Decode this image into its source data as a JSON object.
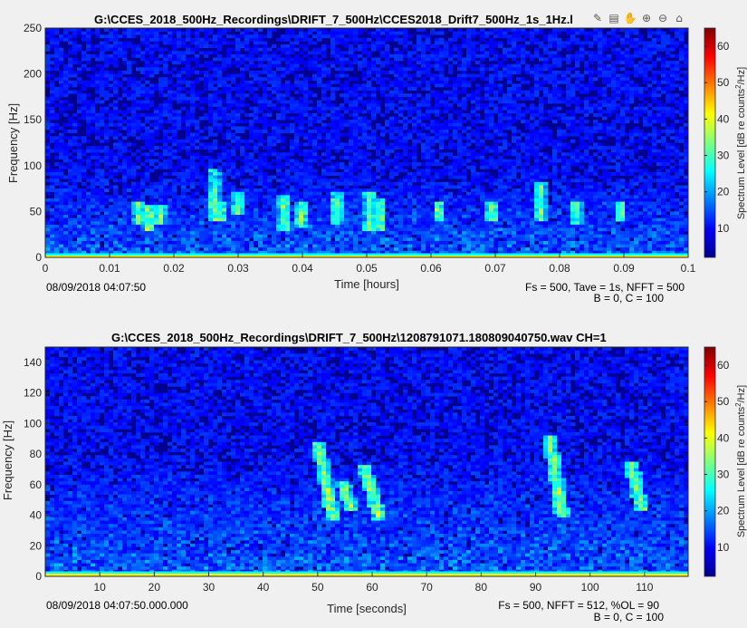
{
  "toolbar": {
    "icons": [
      "brush-icon",
      "legend-icon",
      "pan-hand-icon",
      "zoom-in-icon",
      "zoom-out-icon",
      "home-icon"
    ],
    "glyphs": [
      "✎",
      "▤",
      "✋",
      "⊕",
      "⊖",
      "⌂"
    ]
  },
  "chart_data": [
    {
      "type": "heatmap",
      "title": "G:\\CCES_2018_500Hz_Recordings\\DRIFT_7_500Hz\\CCES2018_Drift7_500Hz_1s_1Hz.l",
      "xlabel": "Time [hours]",
      "ylabel": "Frequency [Hz]",
      "xlim": [
        0,
        0.1
      ],
      "ylim": [
        0,
        250
      ],
      "xticks": [
        "0",
        "0.01",
        "0.02",
        "0.03",
        "0.04",
        "0.05",
        "0.06",
        "0.07",
        "0.08",
        "0.09",
        "0.1"
      ],
      "yticks": [
        "0",
        "50",
        "100",
        "150",
        "200",
        "250"
      ],
      "colorbar": {
        "label": "Spectrum Level [dB re counts²/Hz]",
        "label_main": "Spectrum Level [dB re counts",
        "label_sup": "2",
        "label_end": "/Hz]",
        "ticks": [
          "10",
          "20",
          "30",
          "40",
          "50",
          "60"
        ],
        "range": [
          2,
          65
        ]
      },
      "start_time": "08/09/2018 04:07:50",
      "info_line1": "Fs = 500, Tave = 1s, NFFT = 500",
      "info_line2": "B = 0, C = 100",
      "calls": [
        {
          "t": 0.0145,
          "f_hi": 62,
          "f_lo": 36
        },
        {
          "t": 0.0162,
          "f_hi": 58,
          "f_lo": 30
        },
        {
          "t": 0.0178,
          "f_hi": 56,
          "f_lo": 34
        },
        {
          "t": 0.0262,
          "f_hi": 95,
          "f_lo": 40
        },
        {
          "t": 0.0275,
          "f_hi": 60,
          "f_lo": 38
        },
        {
          "t": 0.03,
          "f_hi": 72,
          "f_lo": 45
        },
        {
          "t": 0.0372,
          "f_hi": 68,
          "f_lo": 28
        },
        {
          "t": 0.0398,
          "f_hi": 62,
          "f_lo": 32
        },
        {
          "t": 0.0452,
          "f_hi": 70,
          "f_lo": 35
        },
        {
          "t": 0.0505,
          "f_hi": 72,
          "f_lo": 30
        },
        {
          "t": 0.0522,
          "f_hi": 65,
          "f_lo": 30
        },
        {
          "t": 0.0612,
          "f_hi": 60,
          "f_lo": 38
        },
        {
          "t": 0.0695,
          "f_hi": 62,
          "f_lo": 40
        },
        {
          "t": 0.077,
          "f_hi": 82,
          "f_lo": 40
        },
        {
          "t": 0.0825,
          "f_hi": 60,
          "f_lo": 35
        },
        {
          "t": 0.0895,
          "f_hi": 62,
          "f_lo": 40
        }
      ]
    },
    {
      "type": "heatmap",
      "title": "G:\\CCES_2018_500Hz_Recordings\\DRIFT_7_500Hz\\1208791071.180809040750.wav CH=1",
      "xlabel": "Time [seconds]",
      "ylabel": "Frequency [Hz]",
      "xlim": [
        0,
        118
      ],
      "ylim": [
        0,
        150
      ],
      "xticks": [
        "10",
        "20",
        "30",
        "40",
        "50",
        "60",
        "70",
        "80",
        "90",
        "100",
        "110"
      ],
      "yticks": [
        "0",
        "20",
        "40",
        "60",
        "80",
        "100",
        "120",
        "140"
      ],
      "colorbar": {
        "label": "Spectrum Level [dB re counts²/Hz]",
        "label_main": "Spectrum Level [dB re counts",
        "label_sup": "2",
        "label_end": "/Hz]",
        "ticks": [
          "10",
          "20",
          "30",
          "40",
          "50",
          "60"
        ],
        "range": [
          2,
          65
        ]
      },
      "start_time": "08/09/2018 04:07:50.000.000",
      "info_line1": "Fs = 500, NFFT = 512, %OL = 90",
      "info_line2": "B = 0, C = 100",
      "calls": [
        {
          "t0": 50.0,
          "t1": 53.0,
          "f_hi": 88,
          "f_lo": 36
        },
        {
          "t0": 54.5,
          "t1": 56.5,
          "f_hi": 62,
          "f_lo": 42
        },
        {
          "t0": 58.5,
          "t1": 61.5,
          "f_hi": 72,
          "f_lo": 36
        },
        {
          "t0": 92.5,
          "t1": 95.0,
          "f_hi": 92,
          "f_lo": 38
        },
        {
          "t0": 107.5,
          "t1": 109.5,
          "f_hi": 75,
          "f_lo": 42
        }
      ]
    }
  ]
}
